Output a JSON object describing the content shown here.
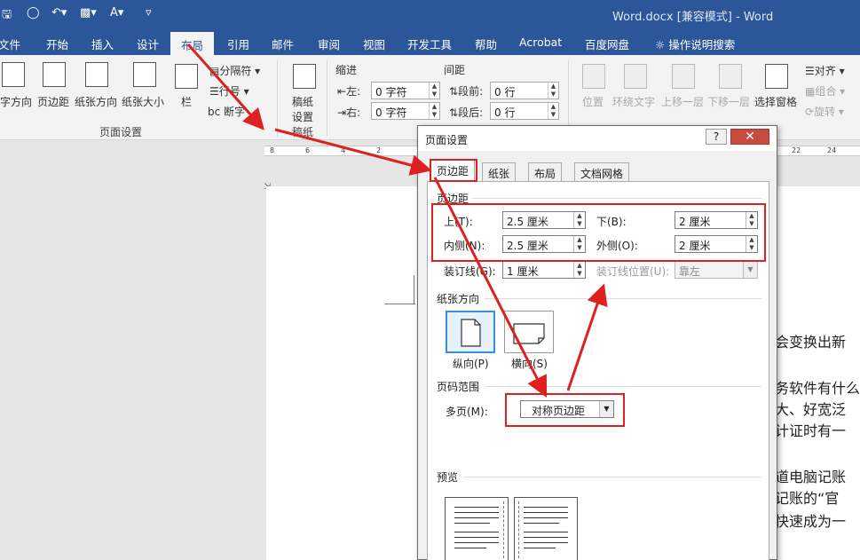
{
  "titlebar": {
    "title": "Word.docx [兼容模式]  -  Word"
  },
  "tabs": [
    {
      "label": "文件"
    },
    {
      "label": "开始"
    },
    {
      "label": "插入"
    },
    {
      "label": "设计"
    },
    {
      "label": "布局",
      "active": true
    },
    {
      "label": "引用"
    },
    {
      "label": "邮件"
    },
    {
      "label": "审阅"
    },
    {
      "label": "视图"
    },
    {
      "label": "开发工具"
    },
    {
      "label": "帮助"
    },
    {
      "label": "Acrobat"
    },
    {
      "label": "百度网盘"
    }
  ],
  "tell_me": "操作说明搜索",
  "ribbon": {
    "page_setup": {
      "text_direction": "字方向",
      "margins": "页边距",
      "orientation": "纸张方向",
      "size": "纸张大小",
      "columns": "栏",
      "breaks": "分隔符",
      "line_numbers": "行号",
      "hyphenation": "断字",
      "group_label": "页面设置"
    },
    "manuscript": {
      "line1": "稿纸",
      "line2": "设置",
      "group_label": "稿纸"
    },
    "paragraph": {
      "indent_label": "缩进",
      "spacing_label": "间距",
      "left_label": "左:",
      "left_value": "0 字符",
      "right_label": "右:",
      "right_value": "0 字符",
      "before_label": "段前:",
      "before_value": "0 行",
      "after_label": "段后:",
      "after_value": "0 行"
    },
    "arrange": {
      "position": "位置",
      "wrap_text": "环绕文字",
      "bring_forward": "上移一层",
      "send_backward": "下移一层",
      "selection_pane": "选择窗格",
      "align": "对齐",
      "group": "组合",
      "rotate": "旋转"
    }
  },
  "ruler": {
    "ticks": [
      "8",
      "6",
      "4",
      "2",
      "22",
      "24"
    ]
  },
  "document": {
    "lines": [
      "会变换出新",
      "务软件有什么",
      "大、好宽泛",
      "计证时有一",
      "道电脑记账",
      "记账的“官",
      "快速成为一"
    ]
  },
  "dialog": {
    "title": "页面设置",
    "help": "?",
    "close": "✕",
    "tabs": [
      "页边距",
      "纸张",
      "布局",
      "文档网格"
    ],
    "margins": {
      "section": "页边距",
      "top_label": "上(T):",
      "top_value": "2.5 厘米",
      "bottom_label": "下(B):",
      "bottom_value": "2 厘米",
      "inside_label": "内侧(N):",
      "inside_value": "2.5 厘米",
      "outside_label": "外侧(O):",
      "outside_value": "2 厘米",
      "gutter_label": "装订线(G):",
      "gutter_value": "1 厘米",
      "gutter_pos_label": "装订线位置(U):",
      "gutter_pos_value": "靠左"
    },
    "orientation": {
      "section": "纸张方向",
      "portrait": "纵向(P)",
      "landscape": "横向(S)"
    },
    "pages": {
      "section": "页码范围",
      "multiple_label": "多页(M):",
      "multiple_value": "对称页边距"
    },
    "preview": {
      "section": "预览"
    }
  },
  "colors": {
    "brand": "#2b579a",
    "highlight": "#e02020",
    "close": "#c94a3f"
  }
}
